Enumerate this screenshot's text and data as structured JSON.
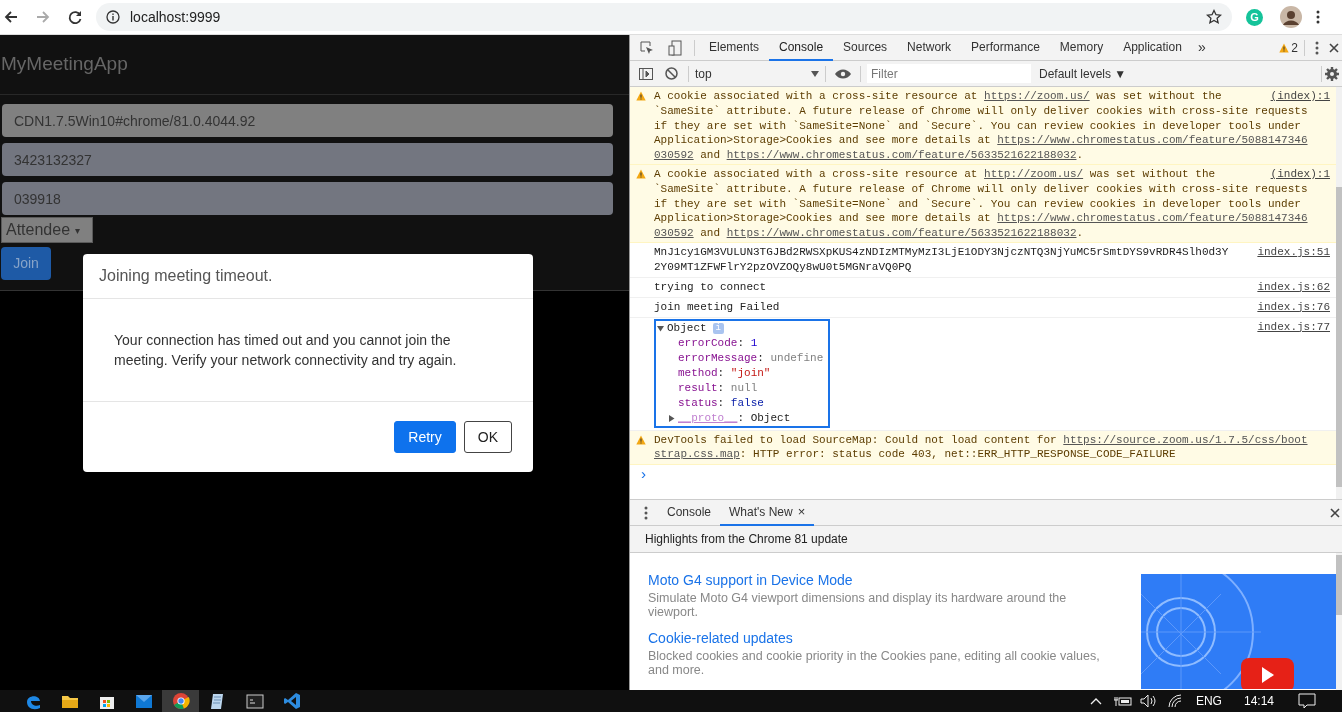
{
  "browser": {
    "address": "localhost:9999",
    "extension_label": "G"
  },
  "page": {
    "brand": "MyMeetingApp",
    "fields": [
      {
        "value": "CDN1.7.5Win10#chrome/81.0.4044.92",
        "disabled": true
      },
      {
        "value": "3423132327",
        "disabled": false
      },
      {
        "value": "039918",
        "disabled": false
      }
    ],
    "role_select": {
      "value": "Attendee",
      "caret": "▾"
    },
    "join_button": "Join"
  },
  "dialog": {
    "title": "Joining meeting timeout.",
    "body": "Your connection has timed out and you cannot join the meeting. Verify your network connectivity and try again.",
    "buttons": [
      {
        "label": "Retry",
        "primary": true
      },
      {
        "label": "OK",
        "primary": false
      }
    ]
  },
  "devtools": {
    "tabs": [
      {
        "label": "Elements",
        "selected": false
      },
      {
        "label": "Console",
        "selected": true
      },
      {
        "label": "Sources",
        "selected": false
      },
      {
        "label": "Network",
        "selected": false
      },
      {
        "label": "Performance",
        "selected": false
      },
      {
        "label": "Memory",
        "selected": false
      },
      {
        "label": "Application",
        "selected": false
      }
    ],
    "more_tabs": "»",
    "warning_count": "2",
    "context": "top",
    "filter_placeholder": "Filter",
    "levels": "Default levels ▼",
    "messages": [
      {
        "kind": "warning",
        "source": "(index):1",
        "lines": [
          [
            {
              "text": "A cookie associated with a cross-site resource at ",
              "link": false
            },
            {
              "text": "https://zoom.us/",
              "link": true
            },
            {
              "text": " was set without the",
              "link": false
            }
          ],
          [
            {
              "text": "`SameSite` attribute. A future release of Chrome will only deliver cookies with cross-site requests",
              "link": false
            }
          ],
          [
            {
              "text": "if they are set with `SameSite=None` and `Secure`. You can review cookies in developer tools under",
              "link": false
            }
          ],
          [
            {
              "text": "Application>Storage>Cookies and see more details at ",
              "link": false
            },
            {
              "text": "https://www.chromestatus.com/feature/5088147346",
              "link": true
            }
          ],
          [
            {
              "text": "030592",
              "link": true
            },
            {
              "text": " and ",
              "link": false
            },
            {
              "text": "https://www.chromestatus.com/feature/5633521622188032",
              "link": true
            },
            {
              "text": ".",
              "link": false
            }
          ]
        ]
      },
      {
        "kind": "warning",
        "source": "(index):1",
        "lines": [
          [
            {
              "text": "A cookie associated with a cross-site resource at ",
              "link": false
            },
            {
              "text": "http://zoom.us/",
              "link": true
            },
            {
              "text": " was set without the",
              "link": false
            }
          ],
          [
            {
              "text": "`SameSite` attribute. A future release of Chrome will only deliver cookies with cross-site requests",
              "link": false
            }
          ],
          [
            {
              "text": "if they are set with `SameSite=None` and `Secure`. You can review cookies in developer tools under",
              "link": false
            }
          ],
          [
            {
              "text": "Application>Storage>Cookies and see more details at ",
              "link": false
            },
            {
              "text": "https://www.chromestatus.com/feature/5088147346",
              "link": true
            }
          ],
          [
            {
              "text": "030592",
              "link": true
            },
            {
              "text": " and ",
              "link": false
            },
            {
              "text": "https://www.chromestatus.com/feature/5633521622188032",
              "link": true
            },
            {
              "text": ".",
              "link": false
            }
          ]
        ]
      },
      {
        "kind": "log",
        "source": "index.js:51",
        "lines": [
          [
            {
              "text": "MnJ1cy1GM3VULUN3TGJBd2RWSXpKUS4zNDIzMTMyMzI3LjE1ODY3NjczNTQ3NjYuMC5rSmtDYS9vRDR4Slh0d3Y",
              "link": false
            }
          ],
          [
            {
              "text": "2Y09MT1ZFWFlrY2pzOVZOQy8wU0t5MGNraVQ0PQ",
              "link": false
            }
          ]
        ]
      },
      {
        "kind": "log",
        "source": "index.js:62",
        "lines": [
          [
            {
              "text": "trying to connect",
              "link": false
            }
          ]
        ]
      },
      {
        "kind": "log",
        "source": "index.js:76",
        "lines": [
          [
            {
              "text": "join meeting Failed",
              "link": false
            }
          ]
        ]
      },
      {
        "kind": "object",
        "source": "index.js:77",
        "label": "Object",
        "info": "i",
        "separator": ":",
        "expanded": true,
        "props": [
          {
            "key": "errorCode",
            "value": "1",
            "kind": "number"
          },
          {
            "key": "errorMessage",
            "value": "undefine",
            "kind": "undefined"
          },
          {
            "key": "method",
            "value": "\"join\"",
            "kind": "string"
          },
          {
            "key": "result",
            "value": "null",
            "kind": "null"
          },
          {
            "key": "status",
            "value": "false",
            "kind": "boolean"
          }
        ],
        "proto": {
          "key": "__proto__",
          "value": "Object"
        }
      },
      {
        "kind": "warning",
        "lines": [
          [
            {
              "text": "DevTools failed to load SourceMap: Could not load content for ",
              "link": false
            },
            {
              "text": "https://source.zoom.us/1.7.5/css/boot",
              "link": true
            }
          ],
          [
            {
              "text": "strap.css.map",
              "link": true
            },
            {
              "text": ": HTTP error: status code 403, net::ERR_HTTP_RESPONSE_CODE_FAILURE",
              "link": false
            }
          ]
        ]
      }
    ],
    "prompt": "›",
    "drawer": {
      "tabs": [
        {
          "label": "Console",
          "selected": false,
          "closable": false
        },
        {
          "label": "What's New",
          "selected": true,
          "closable": true
        }
      ],
      "close_glyph": "×",
      "heading": "Highlights from the Chrome 81 update",
      "items": [
        {
          "title": "Moto G4 support in Device Mode",
          "description": "Simulate Moto G4 viewport dimensions and display its hardware around the viewport."
        },
        {
          "title": "Cookie-related updates",
          "description": "Blocked cookies and cookie priority in the Cookies pane, editing all cookie values, and more."
        }
      ]
    }
  },
  "taskbar": {
    "apps": [
      {
        "kind": "edge",
        "selected": false
      },
      {
        "kind": "folder",
        "selected": false
      },
      {
        "kind": "store",
        "selected": false
      },
      {
        "kind": "mail",
        "selected": false
      },
      {
        "kind": "chrome",
        "selected": true
      },
      {
        "kind": "notepad",
        "selected": false
      },
      {
        "kind": "terminal",
        "selected": false
      },
      {
        "kind": "vscode",
        "selected": false
      }
    ],
    "language": "ENG",
    "time": "14:14"
  }
}
